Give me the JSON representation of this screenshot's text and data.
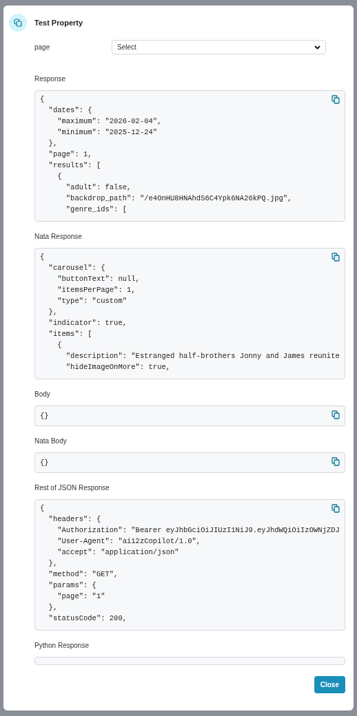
{
  "dialog": {
    "title": "Test Property",
    "fields": [
      {
        "label": "page",
        "placeholder": "Select"
      }
    ],
    "sections": [
      {
        "label": "Response",
        "kind": "code",
        "lines": [
          "{",
          "  \"dates\": {",
          "    \"maximum\": \"2026-02-04\",",
          "    \"minimum\": \"2025-12-24\"",
          "  },",
          "  \"page\": 1,",
          "  \"results\": [",
          "    {",
          "      \"adult\": false,",
          "      \"backdrop_path\": \"/e4OnHU8HNAhdS6C4Ypk6NA26kPQ.jpg\",",
          "      \"genre_ids\": ["
        ]
      },
      {
        "label": "Nata Response",
        "kind": "code",
        "lines": [
          "{",
          "  \"carousel\": {",
          "    \"buttonText\": null,",
          "    \"itemsPerPage\": 1,",
          "    \"type\": \"custom\"",
          "  },",
          "  \"indicator\": true,",
          "  \"items\": [",
          "    {",
          "      \"description\": \"Estranged half-brothers Jonny and James reunite",
          "      \"hideImageOnMore\": true,"
        ]
      },
      {
        "label": "Body",
        "kind": "code",
        "lines": [
          "{}"
        ]
      },
      {
        "label": "Nata Body",
        "kind": "code",
        "lines": [
          "{}"
        ]
      },
      {
        "label": "Rest of JSON Response",
        "kind": "code",
        "lines": [
          "{",
          "  \"headers\": {",
          "    \"Authorization\": \"Bearer eyJhbGciOiJIUzI1NiJ9.eyJhdWQiOiIzOWNjZDJ",
          "    \"User-Agent\": \"ai12zCopilot/1.0\",",
          "    \"accept\": \"application/json\"",
          "  },",
          "  \"method\": \"GET\",",
          "  \"params\": {",
          "    \"page\": \"1\"",
          "  },",
          "  \"statusCode\": 200,"
        ]
      },
      {
        "label": "Python Response",
        "kind": "empty"
      }
    ],
    "buttons": [
      {
        "label": "Close"
      }
    ]
  }
}
